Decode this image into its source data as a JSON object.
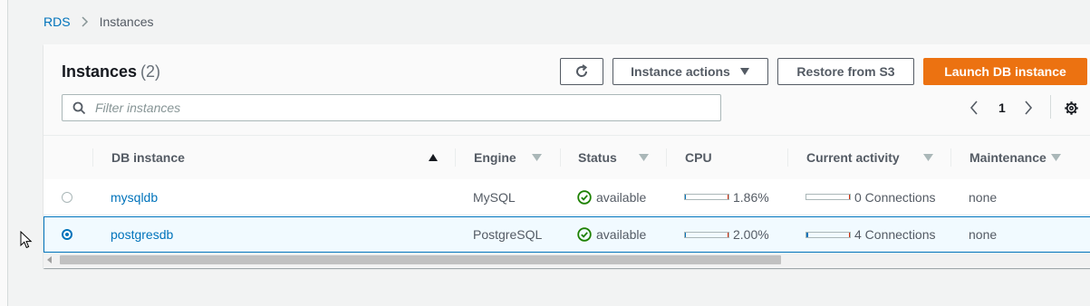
{
  "breadcrumb": {
    "root": "RDS",
    "current": "Instances"
  },
  "panel": {
    "title": "Instances",
    "count": "(2)",
    "buttons": {
      "refresh_icon": "refresh-icon",
      "actions": "Instance actions",
      "restore": "Restore from S3",
      "launch": "Launch DB instance"
    },
    "filter_placeholder": "Filter instances",
    "pagination": {
      "page": "1"
    }
  },
  "table": {
    "columns": [
      "DB instance",
      "Engine",
      "Status",
      "CPU",
      "Current activity",
      "Maintenance"
    ],
    "rows": [
      {
        "selected": false,
        "name": "mysqldb",
        "engine": "MySQL",
        "status": "available",
        "cpu": "1.86%",
        "cpu_fraction": 0.0186,
        "activity": "0 Connections",
        "maintenance": "none"
      },
      {
        "selected": true,
        "name": "postgresdb",
        "engine": "PostgreSQL",
        "status": "available",
        "cpu": "2.00%",
        "cpu_fraction": 0.02,
        "activity": "4 Connections",
        "maintenance": "none"
      }
    ]
  },
  "colors": {
    "accent": "#0073bb",
    "primary_button": "#ec7211",
    "status_ok": "#1d8102"
  }
}
